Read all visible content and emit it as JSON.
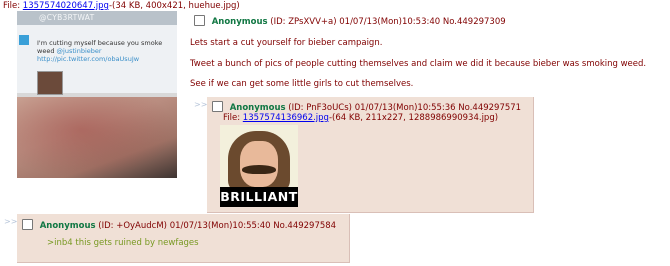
{
  "op": {
    "file_label": "File:",
    "file_link": "1357574020647.jpg",
    "file_meta": "-(34 KB, 400x421, huehue.jpg)",
    "thumb": {
      "tweet_handle": "@CYB3RTWAT",
      "tweet_text": "I'm cutting myself because you smoke weed",
      "tweet_mention": "@justinbieber",
      "tweet_link": "http://pic.twitter.com/obaUsuJw"
    },
    "name": "Anonymous",
    "id": "(ID: ZPsXVV+a)",
    "datetime": "01/07/13(Mon)10:53:40",
    "post_no": "No.449297309",
    "lines": [
      "Lets start a cut yourself for bieber campaign.",
      "Tweet a bunch of pics of people cutting themselves and claim we did it because bieber was smoking weed.",
      "See if we can get some little girls to cut themselves."
    ]
  },
  "replies": [
    {
      "arrows": ">>",
      "name": "Anonymous",
      "id": "(ID: PnF3oUCs)",
      "datetime": "01/07/13(Mon)10:55:36",
      "post_no": "No.449297571",
      "file_label": "File:",
      "file_link": "1357574136962.jpg",
      "file_meta": "-(64 KB, 211x227, 1288986990934.jpg)",
      "thumb_caption": "BRILLIANT"
    },
    {
      "arrows": ">>",
      "name": "Anonymous",
      "id": "(ID: +OyAudcM)",
      "datetime": "01/07/13(Mon)10:55:40",
      "post_no": "No.449297584",
      "greentext": ">inb4 this gets ruined by newfages"
    }
  ],
  "colors": {
    "text": "#800000",
    "name": "#117743",
    "link": "#0000ee",
    "greentext": "#789922",
    "reply_bg": "#f0e0d6",
    "reply_border": "#d9bfb7"
  }
}
